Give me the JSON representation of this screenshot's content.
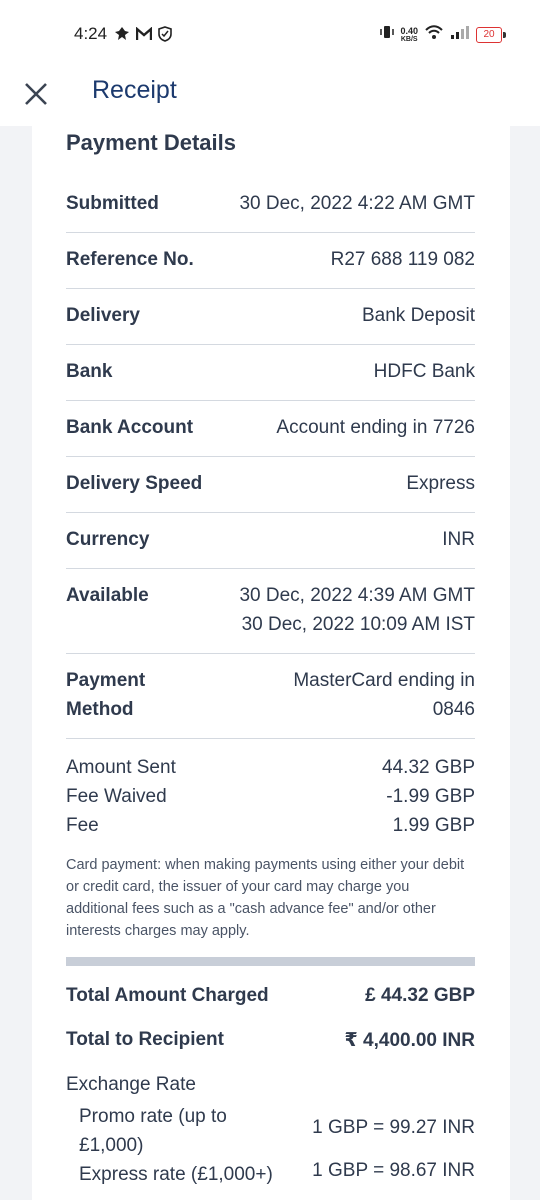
{
  "status_bar": {
    "time": "4:24",
    "net_speed_value": "0.40",
    "net_speed_unit": "KB/S",
    "battery": "20",
    "battery_color": "#dd3333",
    "icons": [
      "notification-icon",
      "gmail-icon",
      "shield-icon",
      "vibrate-icon",
      "wifi-icon",
      "signal-icon",
      "battery-icon"
    ]
  },
  "header": {
    "title": "Receipt",
    "close_icon": "close-icon"
  },
  "payment_details": {
    "title": "Payment Details",
    "rows": [
      {
        "label": "Submitted",
        "value": "30 Dec, 2022 4:22 AM GMT"
      },
      {
        "label": "Reference No.",
        "value": "R27 688 119 082"
      },
      {
        "label": "Delivery",
        "value": "Bank Deposit"
      },
      {
        "label": "Bank",
        "value": "HDFC Bank"
      },
      {
        "label": "Bank Account",
        "value": "Account ending in 7726"
      },
      {
        "label": "Delivery Speed",
        "value": "Express"
      },
      {
        "label": "Currency",
        "value": "INR"
      }
    ],
    "available": {
      "label": "Available",
      "value_line1": "30 Dec, 2022 4:39 AM GMT",
      "value_line2": "30 Dec, 2022 10:09 AM IST"
    },
    "payment_method": {
      "label_line1": "Payment",
      "label_line2": "Method",
      "value_line1": "MasterCard ending in",
      "value_line2": "0846"
    }
  },
  "amounts": [
    {
      "label": "Amount Sent",
      "value": "44.32 GBP"
    },
    {
      "label": "Fee Waived",
      "value": "-1.99 GBP"
    },
    {
      "label": "Fee",
      "value": "1.99 GBP"
    }
  ],
  "disclaimer": "Card payment: when making payments using either your debit or credit card, the issuer of your card may charge you additional fees such as a \"cash advance fee\" and/or other interests charges may apply.",
  "totals": {
    "charged_label": "Total Amount Charged",
    "charged_value": "£ 44.32 GBP",
    "recipient_label": "Total to Recipient",
    "recipient_value": "₹ 4,400.00 INR"
  },
  "exchange_rate": {
    "title": "Exchange Rate",
    "promo_label_line1": "Promo rate (up to",
    "promo_label_line2": "£1,000)",
    "promo_value": "1 GBP = 99.27 INR",
    "express_label": "Express rate (£1,000+)",
    "express_value": "1 GBP = 98.67 INR"
  }
}
